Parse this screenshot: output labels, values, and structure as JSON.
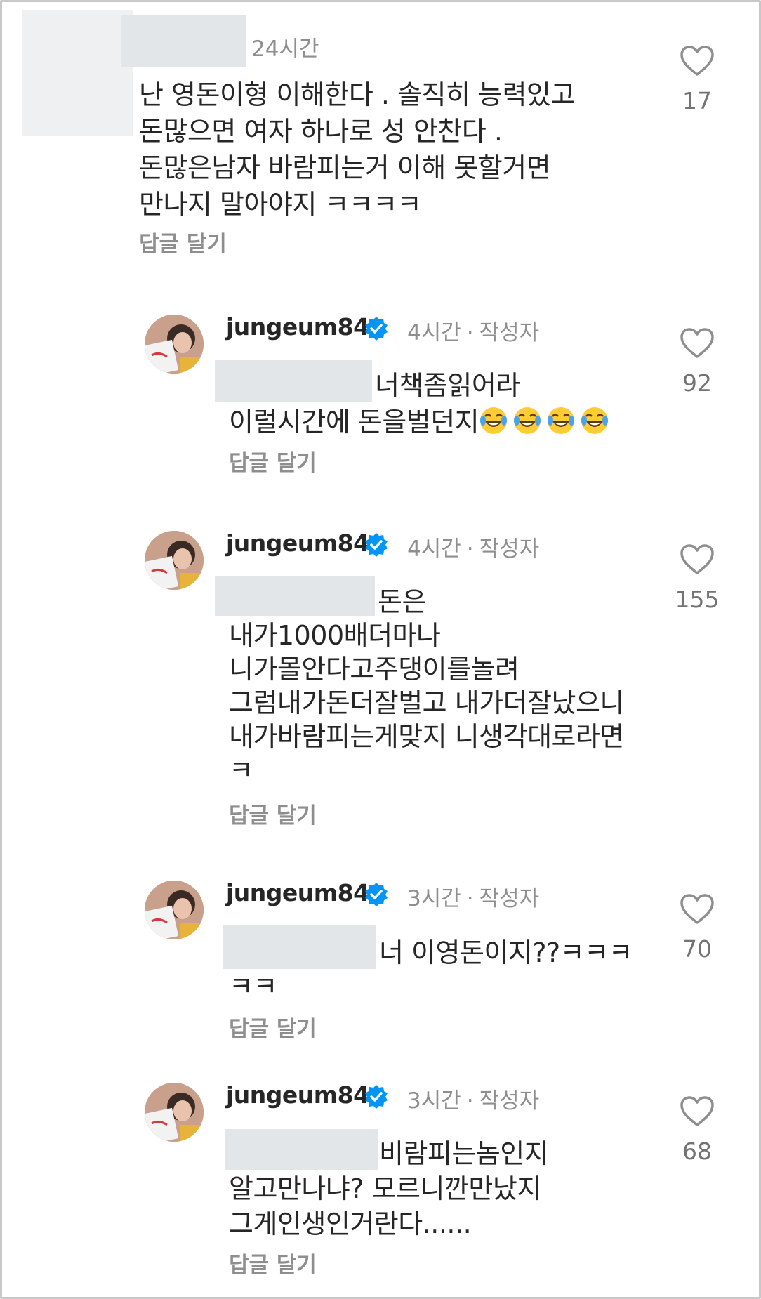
{
  "comments": [
    {
      "time": "24시간",
      "lines": [
        "난 영돈이형 이해한다 . 솔직히 능력있고",
        "돈많으면 여자 하나로 성 안찬다 .",
        "돈많은남자 바람피는거 이해 못할거면",
        "만나지 말아야지 ㅋㅋㅋㅋ"
      ],
      "likes": "17",
      "reply_label": "답글 달기"
    },
    {
      "username": "jungeum84",
      "time": "4시간",
      "author_tag": "작성자",
      "lines": [
        "너책좀읽어라",
        "이럴시간에 돈을벌던지"
      ],
      "emoji": "tears-of-joy",
      "likes": "92",
      "reply_label": "답글 달기"
    },
    {
      "username": "jungeum84",
      "time": "4시간",
      "author_tag": "작성자",
      "lines": [
        "돈은",
        "내가1000배더마나",
        "니가몰안다고주댕이를놀려",
        "그럼내가돈더잘벌고 내가더잘났으니",
        "내가바람피는게맞지 니생각대로라면",
        "ㅋ"
      ],
      "likes": "155",
      "reply_label": "답글 달기"
    },
    {
      "username": "jungeum84",
      "time": "3시간",
      "author_tag": "작성자",
      "lines": [
        "너 이영돈이지??ㅋㅋㅋ",
        "ㅋㅋ"
      ],
      "likes": "70",
      "reply_label": "답글 달기"
    },
    {
      "username": "jungeum84",
      "time": "3시간",
      "author_tag": "작성자",
      "lines": [
        "비람피는놈인지",
        "알고만나냐? 모르니깐만났지",
        "그게인생인거란다......"
      ],
      "likes": "68",
      "reply_label": "답글 달기"
    }
  ],
  "colors": {
    "text": "#262626",
    "muted": "#8e8e8e",
    "verified": "#0095f6",
    "redaction": "#e3e6e8"
  }
}
